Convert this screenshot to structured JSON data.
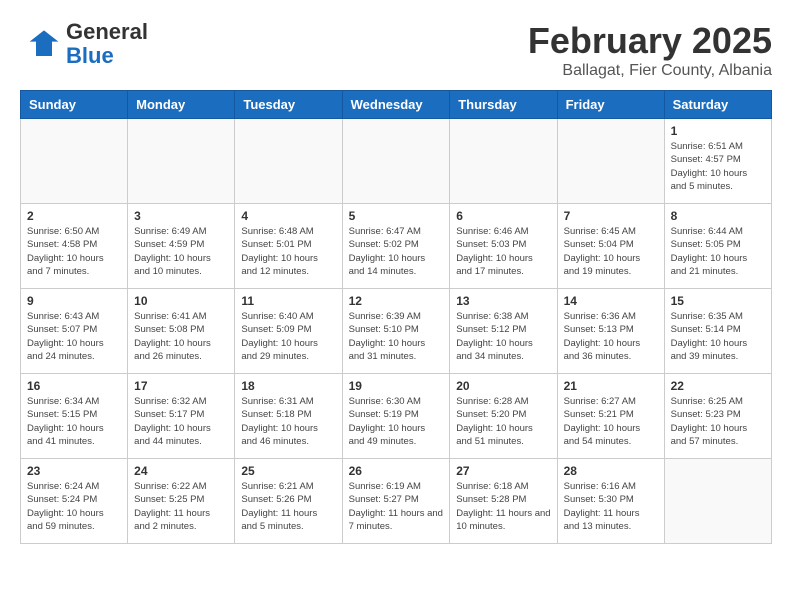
{
  "header": {
    "logo_general": "General",
    "logo_blue": "Blue",
    "title": "February 2025",
    "subtitle": "Ballagat, Fier County, Albania"
  },
  "weekdays": [
    "Sunday",
    "Monday",
    "Tuesday",
    "Wednesday",
    "Thursday",
    "Friday",
    "Saturday"
  ],
  "weeks": [
    [
      {
        "day": "",
        "info": ""
      },
      {
        "day": "",
        "info": ""
      },
      {
        "day": "",
        "info": ""
      },
      {
        "day": "",
        "info": ""
      },
      {
        "day": "",
        "info": ""
      },
      {
        "day": "",
        "info": ""
      },
      {
        "day": "1",
        "info": "Sunrise: 6:51 AM\nSunset: 4:57 PM\nDaylight: 10 hours and 5 minutes."
      }
    ],
    [
      {
        "day": "2",
        "info": "Sunrise: 6:50 AM\nSunset: 4:58 PM\nDaylight: 10 hours and 7 minutes."
      },
      {
        "day": "3",
        "info": "Sunrise: 6:49 AM\nSunset: 4:59 PM\nDaylight: 10 hours and 10 minutes."
      },
      {
        "day": "4",
        "info": "Sunrise: 6:48 AM\nSunset: 5:01 PM\nDaylight: 10 hours and 12 minutes."
      },
      {
        "day": "5",
        "info": "Sunrise: 6:47 AM\nSunset: 5:02 PM\nDaylight: 10 hours and 14 minutes."
      },
      {
        "day": "6",
        "info": "Sunrise: 6:46 AM\nSunset: 5:03 PM\nDaylight: 10 hours and 17 minutes."
      },
      {
        "day": "7",
        "info": "Sunrise: 6:45 AM\nSunset: 5:04 PM\nDaylight: 10 hours and 19 minutes."
      },
      {
        "day": "8",
        "info": "Sunrise: 6:44 AM\nSunset: 5:05 PM\nDaylight: 10 hours and 21 minutes."
      }
    ],
    [
      {
        "day": "9",
        "info": "Sunrise: 6:43 AM\nSunset: 5:07 PM\nDaylight: 10 hours and 24 minutes."
      },
      {
        "day": "10",
        "info": "Sunrise: 6:41 AM\nSunset: 5:08 PM\nDaylight: 10 hours and 26 minutes."
      },
      {
        "day": "11",
        "info": "Sunrise: 6:40 AM\nSunset: 5:09 PM\nDaylight: 10 hours and 29 minutes."
      },
      {
        "day": "12",
        "info": "Sunrise: 6:39 AM\nSunset: 5:10 PM\nDaylight: 10 hours and 31 minutes."
      },
      {
        "day": "13",
        "info": "Sunrise: 6:38 AM\nSunset: 5:12 PM\nDaylight: 10 hours and 34 minutes."
      },
      {
        "day": "14",
        "info": "Sunrise: 6:36 AM\nSunset: 5:13 PM\nDaylight: 10 hours and 36 minutes."
      },
      {
        "day": "15",
        "info": "Sunrise: 6:35 AM\nSunset: 5:14 PM\nDaylight: 10 hours and 39 minutes."
      }
    ],
    [
      {
        "day": "16",
        "info": "Sunrise: 6:34 AM\nSunset: 5:15 PM\nDaylight: 10 hours and 41 minutes."
      },
      {
        "day": "17",
        "info": "Sunrise: 6:32 AM\nSunset: 5:17 PM\nDaylight: 10 hours and 44 minutes."
      },
      {
        "day": "18",
        "info": "Sunrise: 6:31 AM\nSunset: 5:18 PM\nDaylight: 10 hours and 46 minutes."
      },
      {
        "day": "19",
        "info": "Sunrise: 6:30 AM\nSunset: 5:19 PM\nDaylight: 10 hours and 49 minutes."
      },
      {
        "day": "20",
        "info": "Sunrise: 6:28 AM\nSunset: 5:20 PM\nDaylight: 10 hours and 51 minutes."
      },
      {
        "day": "21",
        "info": "Sunrise: 6:27 AM\nSunset: 5:21 PM\nDaylight: 10 hours and 54 minutes."
      },
      {
        "day": "22",
        "info": "Sunrise: 6:25 AM\nSunset: 5:23 PM\nDaylight: 10 hours and 57 minutes."
      }
    ],
    [
      {
        "day": "23",
        "info": "Sunrise: 6:24 AM\nSunset: 5:24 PM\nDaylight: 10 hours and 59 minutes."
      },
      {
        "day": "24",
        "info": "Sunrise: 6:22 AM\nSunset: 5:25 PM\nDaylight: 11 hours and 2 minutes."
      },
      {
        "day": "25",
        "info": "Sunrise: 6:21 AM\nSunset: 5:26 PM\nDaylight: 11 hours and 5 minutes."
      },
      {
        "day": "26",
        "info": "Sunrise: 6:19 AM\nSunset: 5:27 PM\nDaylight: 11 hours and 7 minutes."
      },
      {
        "day": "27",
        "info": "Sunrise: 6:18 AM\nSunset: 5:28 PM\nDaylight: 11 hours and 10 minutes."
      },
      {
        "day": "28",
        "info": "Sunrise: 6:16 AM\nSunset: 5:30 PM\nDaylight: 11 hours and 13 minutes."
      },
      {
        "day": "",
        "info": ""
      }
    ]
  ]
}
